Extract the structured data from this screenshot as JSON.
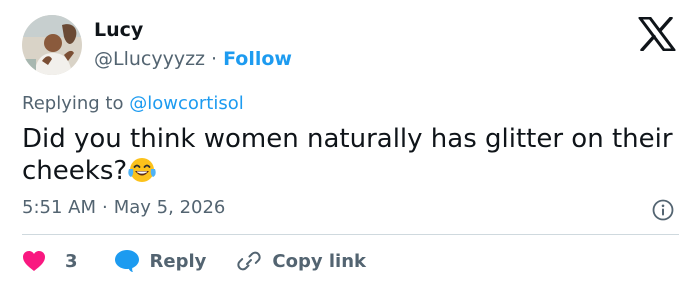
{
  "author": {
    "name": "Lucy",
    "handle": "@Llucyyyzz",
    "separator": "·",
    "follow_label": "Follow"
  },
  "reply_context": {
    "prefix": "Replying to",
    "mention": "@lowcortisol"
  },
  "tweet": {
    "text": "Did you think women naturally has glitter on their cheeks?",
    "emoji": "face-with-tears-of-joy"
  },
  "meta": {
    "time": "5:51 AM",
    "separator": "·",
    "date": "May 5, 2026"
  },
  "actions": {
    "like_count": "3",
    "reply_label": "Reply",
    "copy_label": "Copy link"
  },
  "icons": {
    "brand": "x-logo-icon",
    "like": "heart-icon",
    "reply": "chat-bubble-icon",
    "copy": "link-icon",
    "info": "info-icon"
  },
  "colors": {
    "link": "#1d9bf0",
    "like": "#f91880",
    "reply_icon": "#1d9bf0",
    "muted": "#536471",
    "text": "#0f1419",
    "divider": "#cfd9de"
  }
}
